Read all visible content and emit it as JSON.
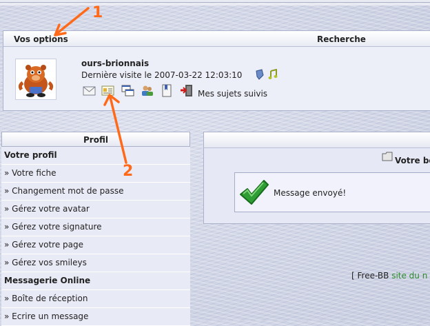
{
  "options": {
    "title": "Vos options",
    "search_title": "Recherche",
    "username": "ours-brionnais",
    "last_visit": "Dernière visite le 2007-03-22 12:03:10",
    "followed_topics": "Mes sujets suivis",
    "icons": [
      "mail-icon",
      "profile-card-icon",
      "windows-icon",
      "users-icon",
      "bookmark-icon",
      "logout-icon"
    ]
  },
  "profile": {
    "title": "Profil",
    "items": [
      {
        "label": "Votre profil",
        "section": true
      },
      {
        "label": "» Votre fiche"
      },
      {
        "label": "» Changement mot de passe"
      },
      {
        "label": "» Gérez votre avatar"
      },
      {
        "label": "» Gérez votre signature"
      },
      {
        "label": "» Gérez votre page"
      },
      {
        "label": "» Gérez vos smileys"
      },
      {
        "label": "Messagerie Online",
        "section": true
      },
      {
        "label": "» Boîte de réception"
      },
      {
        "label": "» Ecrire un message"
      }
    ]
  },
  "content": {
    "votre_label": "Votre be",
    "message": "Message envoyé!"
  },
  "footer": {
    "bracket": "[",
    "brand": "Free-BB",
    "link": "site du n"
  },
  "annotations": {
    "one": "1",
    "two": "2",
    "color": "#ff6a1a"
  }
}
